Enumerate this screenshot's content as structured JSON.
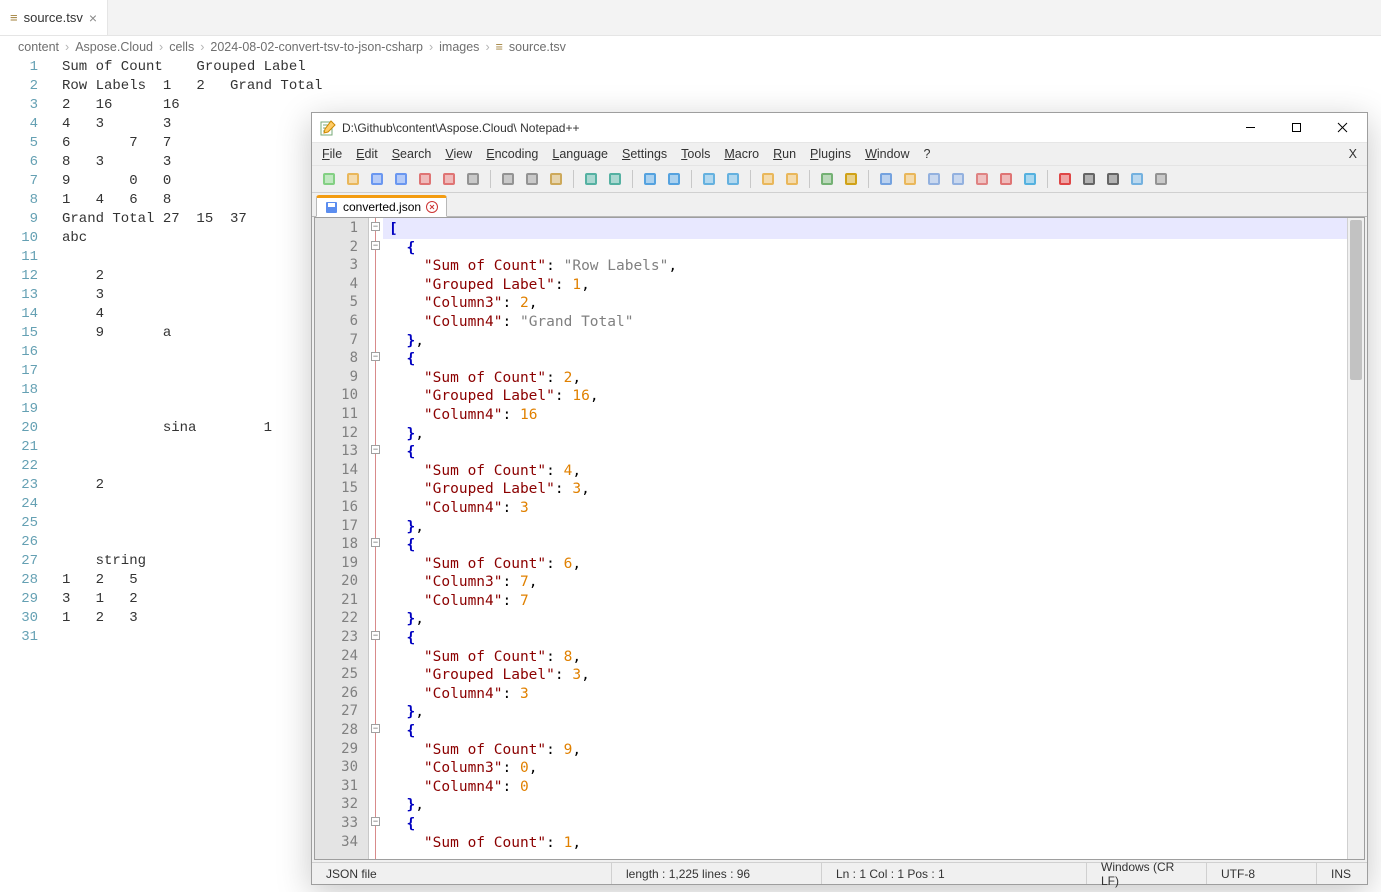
{
  "vscode": {
    "tab": {
      "icon": "≡",
      "label": "source.tsv"
    },
    "breadcrumb": [
      "content",
      "Aspose.Cloud",
      "cells",
      "2024-08-02-convert-tsv-to-json-csharp",
      "images",
      "source.tsv"
    ],
    "last_item_icon": "≡",
    "lines": [
      "Sum of Count    Grouped Label",
      "Row Labels  1   2   Grand Total",
      "2   16      16",
      "4   3       3",
      "6       7   7",
      "8   3       3",
      "9       0   0",
      "1   4   6   8",
      "Grand Total 27  15  37",
      "abc",
      "",
      "    2",
      "    3",
      "    4",
      "    9       a",
      "",
      "",
      "",
      "",
      "            sina        1",
      "",
      "",
      "    2",
      "",
      "",
      "",
      "    string",
      "1   2   5",
      "3   1   2",
      "1   2   3",
      ""
    ]
  },
  "npp": {
    "title": "D:\\Github\\content\\Aspose.Cloud\\ Notepad++",
    "menus": [
      "File",
      "Edit",
      "Search",
      "View",
      "Encoding",
      "Language",
      "Settings",
      "Tools",
      "Macro",
      "Run",
      "Plugins",
      "Window",
      "?"
    ],
    "menu_right": "X",
    "doctab": {
      "label": "converted.json"
    },
    "code_lines": [
      {
        "n": 1,
        "fold": true,
        "tokens": [
          [
            "brace",
            "["
          ]
        ]
      },
      {
        "n": 2,
        "fold": true,
        "tokens": [
          [
            "punc",
            "  "
          ],
          [
            "brace",
            "{"
          ]
        ]
      },
      {
        "n": 3,
        "tokens": [
          [
            "punc",
            "    "
          ],
          [
            "key",
            "\"Sum of Count\""
          ],
          [
            "punc",
            ": "
          ],
          [
            "str",
            "\"Row Labels\""
          ],
          [
            "punc",
            ","
          ]
        ]
      },
      {
        "n": 4,
        "tokens": [
          [
            "punc",
            "    "
          ],
          [
            "key",
            "\"Grouped Label\""
          ],
          [
            "punc",
            ": "
          ],
          [
            "num",
            "1"
          ],
          [
            "punc",
            ","
          ]
        ]
      },
      {
        "n": 5,
        "tokens": [
          [
            "punc",
            "    "
          ],
          [
            "key",
            "\"Column3\""
          ],
          [
            "punc",
            ": "
          ],
          [
            "num",
            "2"
          ],
          [
            "punc",
            ","
          ]
        ]
      },
      {
        "n": 6,
        "tokens": [
          [
            "punc",
            "    "
          ],
          [
            "key",
            "\"Column4\""
          ],
          [
            "punc",
            ": "
          ],
          [
            "str",
            "\"Grand Total\""
          ]
        ]
      },
      {
        "n": 7,
        "tokens": [
          [
            "punc",
            "  "
          ],
          [
            "brace",
            "}"
          ],
          [
            "punc",
            ","
          ]
        ]
      },
      {
        "n": 8,
        "fold": true,
        "tokens": [
          [
            "punc",
            "  "
          ],
          [
            "brace",
            "{"
          ]
        ]
      },
      {
        "n": 9,
        "tokens": [
          [
            "punc",
            "    "
          ],
          [
            "key",
            "\"Sum of Count\""
          ],
          [
            "punc",
            ": "
          ],
          [
            "num",
            "2"
          ],
          [
            "punc",
            ","
          ]
        ]
      },
      {
        "n": 10,
        "tokens": [
          [
            "punc",
            "    "
          ],
          [
            "key",
            "\"Grouped Label\""
          ],
          [
            "punc",
            ": "
          ],
          [
            "num",
            "16"
          ],
          [
            "punc",
            ","
          ]
        ]
      },
      {
        "n": 11,
        "tokens": [
          [
            "punc",
            "    "
          ],
          [
            "key",
            "\"Column4\""
          ],
          [
            "punc",
            ": "
          ],
          [
            "num",
            "16"
          ]
        ]
      },
      {
        "n": 12,
        "tokens": [
          [
            "punc",
            "  "
          ],
          [
            "brace",
            "}"
          ],
          [
            "punc",
            ","
          ]
        ]
      },
      {
        "n": 13,
        "fold": true,
        "tokens": [
          [
            "punc",
            "  "
          ],
          [
            "brace",
            "{"
          ]
        ]
      },
      {
        "n": 14,
        "tokens": [
          [
            "punc",
            "    "
          ],
          [
            "key",
            "\"Sum of Count\""
          ],
          [
            "punc",
            ": "
          ],
          [
            "num",
            "4"
          ],
          [
            "punc",
            ","
          ]
        ]
      },
      {
        "n": 15,
        "tokens": [
          [
            "punc",
            "    "
          ],
          [
            "key",
            "\"Grouped Label\""
          ],
          [
            "punc",
            ": "
          ],
          [
            "num",
            "3"
          ],
          [
            "punc",
            ","
          ]
        ]
      },
      {
        "n": 16,
        "tokens": [
          [
            "punc",
            "    "
          ],
          [
            "key",
            "\"Column4\""
          ],
          [
            "punc",
            ": "
          ],
          [
            "num",
            "3"
          ]
        ]
      },
      {
        "n": 17,
        "tokens": [
          [
            "punc",
            "  "
          ],
          [
            "brace",
            "}"
          ],
          [
            "punc",
            ","
          ]
        ]
      },
      {
        "n": 18,
        "fold": true,
        "tokens": [
          [
            "punc",
            "  "
          ],
          [
            "brace",
            "{"
          ]
        ]
      },
      {
        "n": 19,
        "tokens": [
          [
            "punc",
            "    "
          ],
          [
            "key",
            "\"Sum of Count\""
          ],
          [
            "punc",
            ": "
          ],
          [
            "num",
            "6"
          ],
          [
            "punc",
            ","
          ]
        ]
      },
      {
        "n": 20,
        "tokens": [
          [
            "punc",
            "    "
          ],
          [
            "key",
            "\"Column3\""
          ],
          [
            "punc",
            ": "
          ],
          [
            "num",
            "7"
          ],
          [
            "punc",
            ","
          ]
        ]
      },
      {
        "n": 21,
        "tokens": [
          [
            "punc",
            "    "
          ],
          [
            "key",
            "\"Column4\""
          ],
          [
            "punc",
            ": "
          ],
          [
            "num",
            "7"
          ]
        ]
      },
      {
        "n": 22,
        "tokens": [
          [
            "punc",
            "  "
          ],
          [
            "brace",
            "}"
          ],
          [
            "punc",
            ","
          ]
        ]
      },
      {
        "n": 23,
        "fold": true,
        "tokens": [
          [
            "punc",
            "  "
          ],
          [
            "brace",
            "{"
          ]
        ]
      },
      {
        "n": 24,
        "tokens": [
          [
            "punc",
            "    "
          ],
          [
            "key",
            "\"Sum of Count\""
          ],
          [
            "punc",
            ": "
          ],
          [
            "num",
            "8"
          ],
          [
            "punc",
            ","
          ]
        ]
      },
      {
        "n": 25,
        "tokens": [
          [
            "punc",
            "    "
          ],
          [
            "key",
            "\"Grouped Label\""
          ],
          [
            "punc",
            ": "
          ],
          [
            "num",
            "3"
          ],
          [
            "punc",
            ","
          ]
        ]
      },
      {
        "n": 26,
        "tokens": [
          [
            "punc",
            "    "
          ],
          [
            "key",
            "\"Column4\""
          ],
          [
            "punc",
            ": "
          ],
          [
            "num",
            "3"
          ]
        ]
      },
      {
        "n": 27,
        "tokens": [
          [
            "punc",
            "  "
          ],
          [
            "brace",
            "}"
          ],
          [
            "punc",
            ","
          ]
        ]
      },
      {
        "n": 28,
        "fold": true,
        "tokens": [
          [
            "punc",
            "  "
          ],
          [
            "brace",
            "{"
          ]
        ]
      },
      {
        "n": 29,
        "tokens": [
          [
            "punc",
            "    "
          ],
          [
            "key",
            "\"Sum of Count\""
          ],
          [
            "punc",
            ": "
          ],
          [
            "num",
            "9"
          ],
          [
            "punc",
            ","
          ]
        ]
      },
      {
        "n": 30,
        "tokens": [
          [
            "punc",
            "    "
          ],
          [
            "key",
            "\"Column3\""
          ],
          [
            "punc",
            ": "
          ],
          [
            "num",
            "0"
          ],
          [
            "punc",
            ","
          ]
        ]
      },
      {
        "n": 31,
        "tokens": [
          [
            "punc",
            "    "
          ],
          [
            "key",
            "\"Column4\""
          ],
          [
            "punc",
            ": "
          ],
          [
            "num",
            "0"
          ]
        ]
      },
      {
        "n": 32,
        "tokens": [
          [
            "punc",
            "  "
          ],
          [
            "brace",
            "}"
          ],
          [
            "punc",
            ","
          ]
        ]
      },
      {
        "n": 33,
        "fold": true,
        "tokens": [
          [
            "punc",
            "  "
          ],
          [
            "brace",
            "{"
          ]
        ]
      },
      {
        "n": 34,
        "tokens": [
          [
            "punc",
            "    "
          ],
          [
            "key",
            "\"Sum of Count\""
          ],
          [
            "punc",
            ": "
          ],
          [
            "num",
            "1"
          ],
          [
            "punc",
            ","
          ]
        ]
      }
    ],
    "status": {
      "filetype": "JSON file",
      "length": "length : 1,225   lines : 96",
      "pos": "Ln : 1   Col : 1   Pos : 1",
      "eol": "Windows (CR LF)",
      "enc": "UTF-8",
      "ins": "INS"
    },
    "toolbar_icons": [
      "new-icon",
      "open-icon",
      "save-icon",
      "save-all-icon",
      "close-icon",
      "close-all-icon",
      "print-icon",
      "sep",
      "cut-icon",
      "copy-icon",
      "paste-icon",
      "sep",
      "undo-icon",
      "redo-icon",
      "sep",
      "find-icon",
      "replace-icon",
      "sep",
      "zoom-in-icon",
      "zoom-out-icon",
      "sep",
      "sync-v-icon",
      "sync-h-icon",
      "sep",
      "wrap-icon",
      "all-chars-icon",
      "sep",
      "indent-guide-icon",
      "lang-icon",
      "doc-map-icon",
      "doc-list-icon",
      "func-list-icon",
      "folder-icon",
      "monitor-icon",
      "sep",
      "record-icon",
      "stop-icon",
      "play-icon",
      "play-multi-icon",
      "save-macro-icon"
    ]
  }
}
